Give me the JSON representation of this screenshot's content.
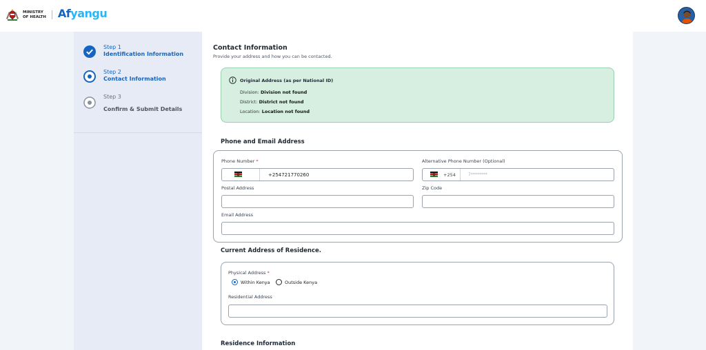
{
  "header": {
    "ministry_line1": "MINISTRY",
    "ministry_line2": "OF HEALTH",
    "brand_part1": "Af",
    "brand_part2": "yangu"
  },
  "steps": [
    {
      "number": "Step 1",
      "title": "Identification Information",
      "state": "complete"
    },
    {
      "number": "Step 2",
      "title": "Contact Information",
      "state": "active"
    },
    {
      "number": "Step 3",
      "title": "Confirm & Submit Details",
      "state": "pending"
    }
  ],
  "contact": {
    "title": "Contact Information",
    "subtitle": "Provide your address and how you can be contacted."
  },
  "original_address": {
    "title": "Original Address (as per National ID)",
    "division_label": "Division:",
    "division_value": "Division not found",
    "district_label": "District:",
    "district_value": "District not found",
    "location_label": "Location:",
    "location_value": "Location not found"
  },
  "phone_email": {
    "section_title": "Phone and Email Address",
    "phone_label": "Phone Number",
    "phone_required": "*",
    "phone_value": "+254721770260",
    "alt_phone_label": "Alternative Phone Number (Optional)",
    "alt_phone_code": "+254",
    "alt_phone_placeholder": "7********",
    "postal_label": "Postal Address",
    "zip_label": "Zip Code",
    "email_label": "Email Address"
  },
  "residence": {
    "section_title": "Current Address of Residence.",
    "physical_label": "Physical Address",
    "physical_required": "*",
    "option_within": "Within Kenya",
    "option_outside": "Outside Kenya",
    "selected": "Within Kenya",
    "residential_label": "Residential Address"
  },
  "residence_info": {
    "section_title": "Residence Information"
  },
  "colors": {
    "primary": "#1565c0",
    "brand_accent": "#29b6f6",
    "success_bg": "#d6efe0",
    "required": "#d32f2f"
  }
}
